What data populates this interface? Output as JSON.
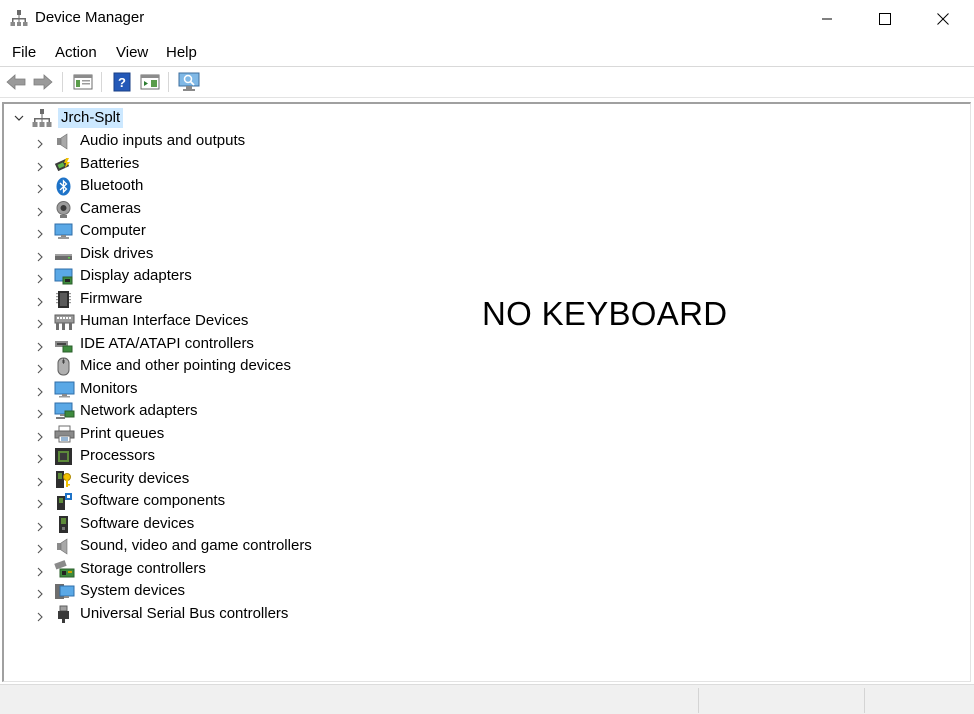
{
  "window": {
    "title": "Device Manager",
    "controls": [
      "minimize",
      "maximize",
      "close"
    ]
  },
  "menu": {
    "file": "File",
    "action": "Action",
    "view": "View",
    "help": "Help"
  },
  "toolbar": {
    "buttons": [
      "back-arrow-icon",
      "forward-arrow-icon",
      "properties-icon",
      "help-icon",
      "update-driver-icon",
      "scan-hardware-icon"
    ]
  },
  "tree": {
    "root": {
      "label": "Jrch-Splt",
      "expanded": true,
      "selected": true
    },
    "categories": [
      {
        "label": "Audio inputs and outputs",
        "icon": "speaker-icon"
      },
      {
        "label": "Batteries",
        "icon": "battery-icon"
      },
      {
        "label": "Bluetooth",
        "icon": "bluetooth-icon"
      },
      {
        "label": "Cameras",
        "icon": "camera-icon"
      },
      {
        "label": "Computer",
        "icon": "computer-icon"
      },
      {
        "label": "Disk drives",
        "icon": "disk-drive-icon"
      },
      {
        "label": "Display adapters",
        "icon": "display-adapter-icon"
      },
      {
        "label": "Firmware",
        "icon": "firmware-icon"
      },
      {
        "label": "Human Interface Devices",
        "icon": "hid-icon"
      },
      {
        "label": "IDE ATA/ATAPI controllers",
        "icon": "ide-controller-icon"
      },
      {
        "label": "Mice and other pointing devices",
        "icon": "mouse-icon"
      },
      {
        "label": "Monitors",
        "icon": "monitor-icon"
      },
      {
        "label": "Network adapters",
        "icon": "network-adapter-icon"
      },
      {
        "label": "Print queues",
        "icon": "printer-icon"
      },
      {
        "label": "Processors",
        "icon": "processor-icon"
      },
      {
        "label": "Security devices",
        "icon": "security-device-icon"
      },
      {
        "label": "Software components",
        "icon": "software-component-icon"
      },
      {
        "label": "Software devices",
        "icon": "software-device-icon"
      },
      {
        "label": "Sound, video and game controllers",
        "icon": "sound-controller-icon"
      },
      {
        "label": "Storage controllers",
        "icon": "storage-controller-icon"
      },
      {
        "label": "System devices",
        "icon": "system-device-icon"
      },
      {
        "label": "Universal Serial Bus controllers",
        "icon": "usb-icon"
      }
    ]
  },
  "overlay": {
    "text": "NO KEYBOARD"
  },
  "colors": {
    "selection": "#cce8ff",
    "accent": "#1e73c8"
  }
}
